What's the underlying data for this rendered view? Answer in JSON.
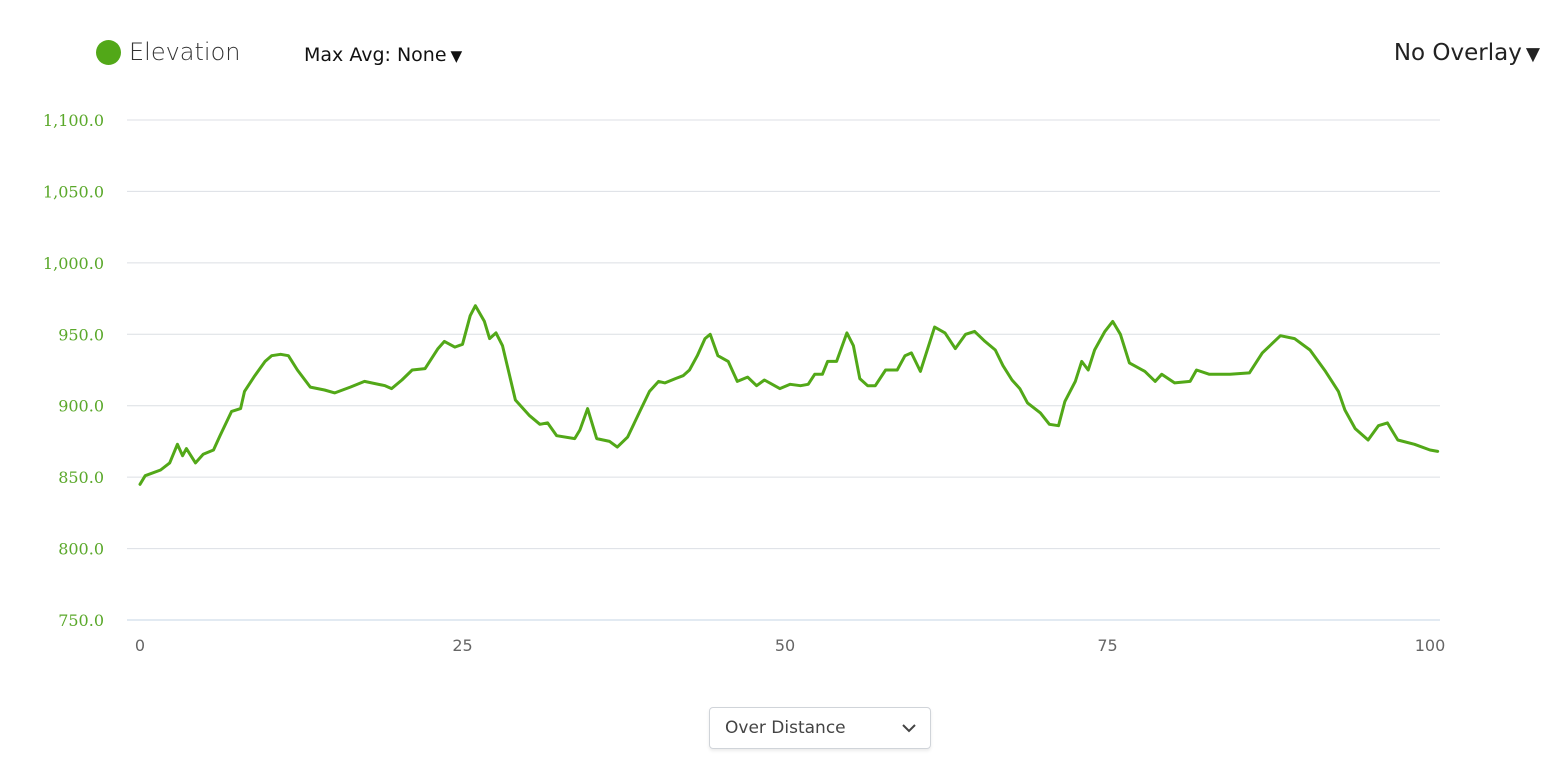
{
  "legend": {
    "label": "Elevation",
    "color": "#52a818"
  },
  "max_avg": {
    "label": "Max Avg: None",
    "icon": "caret-down-icon"
  },
  "overlay": {
    "label": "No Overlay",
    "icon": "caret-down-icon"
  },
  "mode_select": {
    "value": "Over Distance",
    "icon": "chevron-down-icon"
  },
  "chart_data": {
    "type": "line",
    "title": "",
    "xlabel": "",
    "ylabel": "",
    "xlim": [
      0,
      100.6
    ],
    "ylim": [
      750,
      1100
    ],
    "grid": true,
    "legend_placement": "top-left",
    "x_ticks": [
      "0",
      "25",
      "50",
      "75",
      "100"
    ],
    "y_ticks": [
      "750.0",
      "800.0",
      "850.0",
      "900.0",
      "950.0",
      "1,000.0",
      "1,050.0",
      "1,100.0"
    ],
    "series": [
      {
        "name": "Elevation",
        "color": "#52a818",
        "x": [
          0,
          0.4,
          1.6,
          2.3,
          2.9,
          3.3,
          3.6,
          4.3,
          4.9,
          5.7,
          6.2,
          7.1,
          7.8,
          8.1,
          8.9,
          9.7,
          10.2,
          10.9,
          11.5,
          12.2,
          13.2,
          14.3,
          15.1,
          16.3,
          17.4,
          19.0,
          19.5,
          20.3,
          21.1,
          22.1,
          23.1,
          23.6,
          24.4,
          25.0,
          25.6,
          26.0,
          26.7,
          27.1,
          27.6,
          28.1,
          29.1,
          30.2,
          31.0,
          31.6,
          32.3,
          33.7,
          34.1,
          34.7,
          35.4,
          36.4,
          37.0,
          37.8,
          38.8,
          39.5,
          40.2,
          40.7,
          41.5,
          42.1,
          42.6,
          43.2,
          43.8,
          44.2,
          44.8,
          45.6,
          46.3,
          47.1,
          47.8,
          48.4,
          49.6,
          50.4,
          51.2,
          51.8,
          52.3,
          52.9,
          53.3,
          54.0,
          54.8,
          55.3,
          55.8,
          56.4,
          57.0,
          57.8,
          58.7,
          59.3,
          59.8,
          60.5,
          61.6,
          62.4,
          63.2,
          64.0,
          64.7,
          65.5,
          66.3,
          66.9,
          67.6,
          68.2,
          68.8,
          69.8,
          70.5,
          71.2,
          71.7,
          72.5,
          73.0,
          73.5,
          74.0,
          74.8,
          75.4,
          76.0,
          76.7,
          77.9,
          78.7,
          79.2,
          80.2,
          81.4,
          81.9,
          82.9,
          84.5,
          86.0,
          87.0,
          88.4,
          89.5,
          90.7,
          91.9,
          92.9,
          93.4,
          94.2,
          95.2,
          96.0,
          96.7,
          97.5,
          98.8,
          100.0,
          100.6
        ],
        "y": [
          845,
          851,
          855,
          860,
          873,
          865,
          870,
          860,
          866,
          869,
          879,
          896,
          898,
          910,
          921,
          931,
          935,
          936,
          935,
          925,
          913,
          911,
          909,
          913,
          917,
          914,
          912,
          918,
          925,
          926,
          940,
          945,
          941,
          943,
          963,
          970,
          959,
          947,
          951,
          942,
          904,
          893,
          887,
          888,
          879,
          877,
          883,
          898,
          877,
          875,
          871,
          878,
          897,
          910,
          917,
          916,
          919,
          921,
          925,
          935,
          947,
          950,
          935,
          931,
          917,
          920,
          914,
          918,
          912,
          915,
          914,
          915,
          922,
          922,
          931,
          931,
          951,
          942,
          919,
          914,
          914,
          925,
          925,
          935,
          937,
          924,
          955,
          951,
          940,
          950,
          952,
          945,
          939,
          928,
          918,
          912,
          902,
          895,
          887,
          886,
          903,
          917,
          931,
          925,
          939,
          952,
          959,
          950,
          930,
          924,
          917,
          922,
          916,
          917,
          925,
          922,
          922,
          923,
          937,
          949,
          947,
          939,
          924,
          910,
          897,
          884,
          876,
          886,
          888,
          876,
          873,
          869,
          868
        ]
      }
    ]
  }
}
